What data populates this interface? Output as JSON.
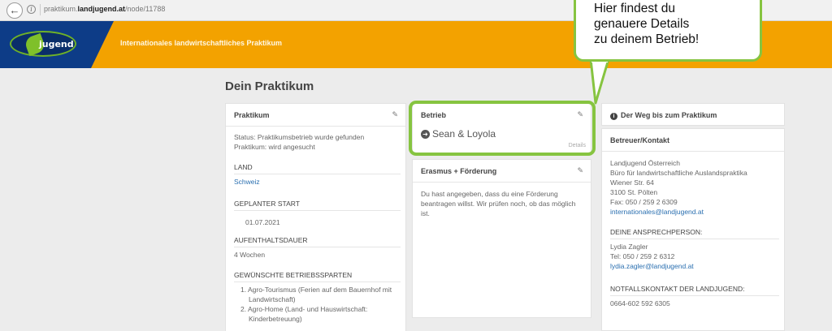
{
  "browser": {
    "back_glyph": "←",
    "info_glyph": "i",
    "url_prefix": "praktikum.",
    "url_domain": "landjugend.at",
    "url_path": "/node/11788"
  },
  "header": {
    "logo_text": "jugend",
    "title": "Internationales landwirtschaftliches Praktikum"
  },
  "page_title": "Dein Praktikum",
  "praktikum": {
    "title": "Praktikum",
    "status_line1": "Status: Praktikumsbetrieb wurde gefunden",
    "status_line2": "Praktikum: wird angesucht",
    "land_label": "LAND",
    "land_value": "Schweiz",
    "start_label": "GEPLANTER START",
    "start_value": "01.07.2021",
    "dauer_label": "AUFENTHALTSDAUER",
    "dauer_value": "4 Wochen",
    "sparten_label": "GEWÜNSCHTE BETRIEBSSPARTEN",
    "sparten": [
      "1. Agro-Tourismus (Ferien auf dem Bauernhof mit Landwirtschaft)",
      "2. Agro-Home (Land- und Hauswirtschaft: Kinderbetreuung)"
    ]
  },
  "betrieb": {
    "title": "Betrieb",
    "name": "Sean & Loyola",
    "details": "Details"
  },
  "erasmus": {
    "title": "Erasmus + Förderung",
    "text": "Du hast angegeben, dass du eine Förderung beantragen willst. Wir prüfen noch, ob das möglich ist."
  },
  "weg": {
    "title": "Der Weg bis zum Praktikum"
  },
  "kontakt": {
    "title": "Betreuer/Kontakt",
    "org_lines": [
      "Landjugend Österreich",
      "Büro für landwirtschaftliche Auslandspraktika",
      "Wiener Str. 64",
      "3100 St. Pölten",
      "Fax: 050 / 259 2 6309"
    ],
    "org_email": "internationales@landjugend.at",
    "person_label": "DEINE ANSPRECHPERSON:",
    "person_name": "Lydia Zagler",
    "person_tel": "Tel: 050 / 259 2 6312",
    "person_email": "lydia.zagler@landjugend.at",
    "notfall_label": "NOTFALLSKONTAKT DER LANDJUGEND:",
    "notfall_value": "0664-602 592 6305"
  },
  "callout": {
    "lines": [
      "Hier findest du",
      "genauere Details",
      "zu deinem Betrieb!"
    ]
  },
  "colors": {
    "orange": "#f3a200",
    "navy": "#0d3c87",
    "green": "#86c440",
    "link": "#2a6fb0"
  }
}
